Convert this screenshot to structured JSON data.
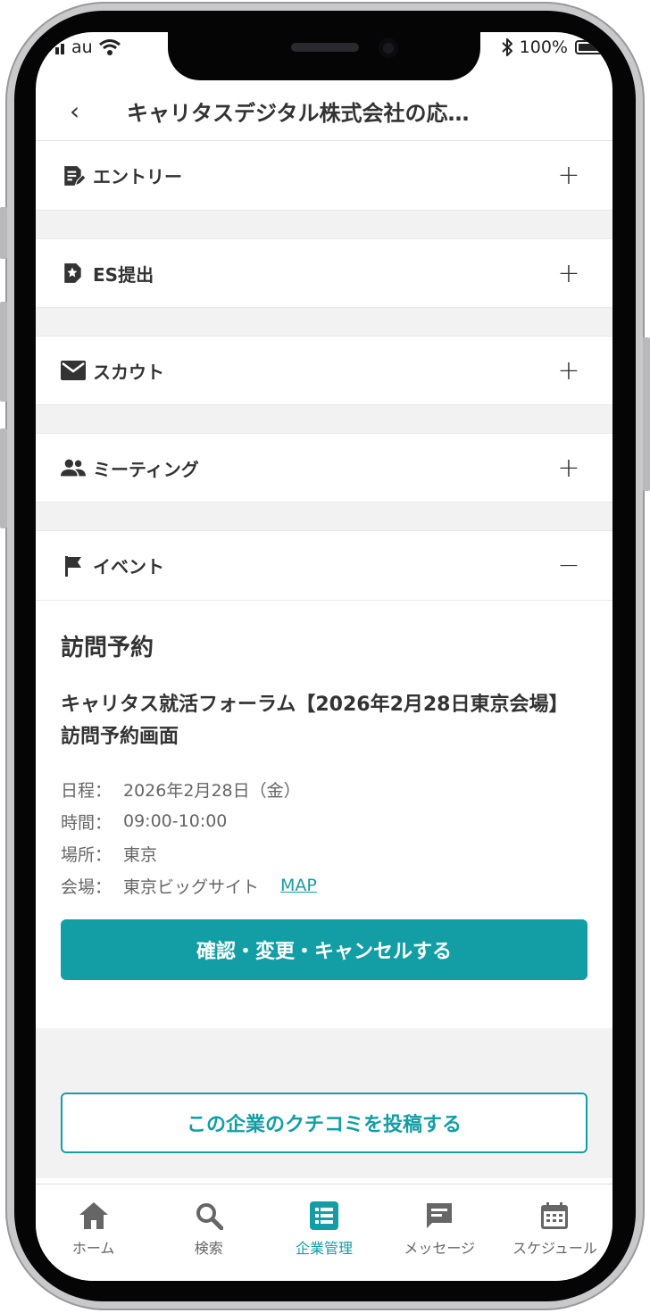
{
  "status_bar": {
    "carrier": "au",
    "battery": "100%"
  },
  "header": {
    "back_label": "‹",
    "title": "キャリタスデジタル株式会社の応…"
  },
  "accordion": [
    {
      "label": "エントリー",
      "icon": "document-edit-icon",
      "toggle": "+"
    },
    {
      "label": "ES提出",
      "icon": "es-submit-icon",
      "toggle": "+"
    },
    {
      "label": "スカウト",
      "icon": "envelope-icon",
      "toggle": "+"
    },
    {
      "label": "ミーティング",
      "icon": "people-icon",
      "toggle": "+"
    },
    {
      "label": "イベント",
      "icon": "flag-icon",
      "toggle": "−"
    }
  ],
  "event": {
    "section_title": "訪問予約",
    "name": "キャリタス就活フォーラム【2026年2月28日東京会場】訪問予約画面",
    "details": [
      {
        "key": "日程：",
        "value": "2026年2月28日（金）"
      },
      {
        "key": "時間：",
        "value": "09:00-10:00"
      },
      {
        "key": "場所：",
        "value": "東京"
      },
      {
        "key": "会場：",
        "value": "東京ビッグサイト"
      }
    ],
    "map_label": "MAP",
    "primary_button": "確認・変更・キャンセルする"
  },
  "review_button": "この企業のクチコミを投稿する",
  "tabbar": [
    {
      "label": "ホーム",
      "icon": "home-icon",
      "active": false
    },
    {
      "label": "検索",
      "icon": "search-icon",
      "active": false
    },
    {
      "label": "企業管理",
      "icon": "list-icon",
      "active": true
    },
    {
      "label": "メッセージ",
      "icon": "message-icon",
      "active": false
    },
    {
      "label": "スケジュール",
      "icon": "calendar-icon",
      "active": false
    }
  ],
  "colors": {
    "accent": "#139ea6",
    "text": "#333333",
    "muted": "#666666",
    "gap": "#f2f2f2"
  }
}
